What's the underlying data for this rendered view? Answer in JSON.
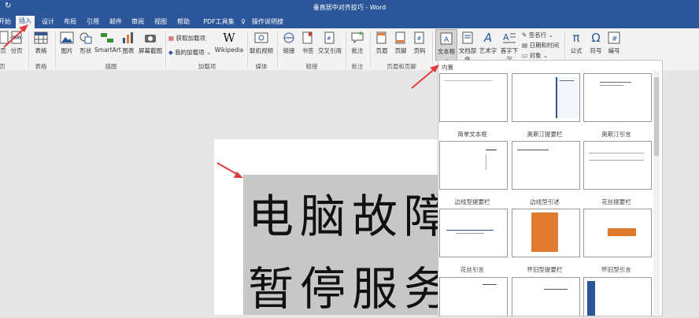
{
  "titlebar": {
    "title": "垂直居中对齐技巧  -  Word"
  },
  "tabs": [
    "开始",
    "插入",
    "设计",
    "布局",
    "引用",
    "邮件",
    "审阅",
    "视图",
    "帮助",
    "PDF工具集",
    "操作说明搜索"
  ],
  "ribbon": {
    "pages": "分页",
    "pages_left": "页",
    "table": "表格",
    "picture": "图片",
    "shapes": "形状",
    "smartart": "SmartArt",
    "chart": "图表",
    "screenshot": "屏幕截图",
    "get_addins": "获取加载项",
    "my_addins": "我的加载项",
    "wikipedia": "Wikipedia",
    "online_video": "联机视频",
    "link": "链接",
    "bookmark": "书签",
    "cross_ref": "交叉引用",
    "comment": "批注",
    "header": "页眉",
    "footer": "页脚",
    "page_number": "页码",
    "textbox": "文本框",
    "quick_parts": "文档部件",
    "wordart": "艺术字",
    "dropcap": "首字下沉",
    "signature": "签名行",
    "datetime": "日期和时间",
    "object": "对象",
    "equation": "公式",
    "symbol": "符号",
    "number": "编号",
    "groups": {
      "pages": "页",
      "table": "表格",
      "illustrations": "插图",
      "addins": "加载项",
      "media": "媒体",
      "links": "链接",
      "comments": "批注",
      "header_footer": "页眉和页脚"
    }
  },
  "document": {
    "line1": "电脑故障",
    "line2": "暂停服务"
  },
  "gallery": {
    "header": "内置",
    "captions": [
      "简单文本框",
      "奥斯汀提要栏",
      "奥斯汀引言",
      "边线型提要栏",
      "边线型引述",
      "花丝提要栏",
      "花丝引言",
      "怀旧型提要栏",
      "怀旧型引言"
    ]
  },
  "colors": {
    "brand": "#2b579a",
    "accent_orange": "#e07a2e",
    "arrow": "#e23b3b"
  }
}
